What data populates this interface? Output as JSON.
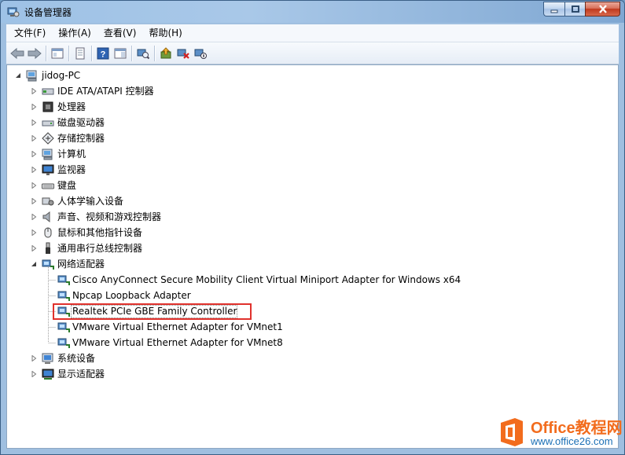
{
  "window": {
    "title": "设备管理器"
  },
  "menu": [
    {
      "key": "file",
      "label": "文件(F)"
    },
    {
      "key": "action",
      "label": "操作(A)"
    },
    {
      "key": "view",
      "label": "查看(V)"
    },
    {
      "key": "help",
      "label": "帮助(H)"
    }
  ],
  "tree": {
    "root": "jidog-PC",
    "categories": [
      {
        "key": "ide",
        "label": "IDE ATA/ATAPI 控制器",
        "icon": "ide-controller-icon"
      },
      {
        "key": "cpu",
        "label": "处理器",
        "icon": "processor-icon"
      },
      {
        "key": "disk",
        "label": "磁盘驱动器",
        "icon": "disk-drive-icon"
      },
      {
        "key": "storage",
        "label": "存储控制器",
        "icon": "storage-controller-icon"
      },
      {
        "key": "computer",
        "label": "计算机",
        "icon": "computer-icon"
      },
      {
        "key": "monitor",
        "label": "监视器",
        "icon": "monitor-icon"
      },
      {
        "key": "keyboard",
        "label": "键盘",
        "icon": "keyboard-icon"
      },
      {
        "key": "hid",
        "label": "人体学输入设备",
        "icon": "hid-icon"
      },
      {
        "key": "sound",
        "label": "声音、视频和游戏控制器",
        "icon": "speaker-icon"
      },
      {
        "key": "mouse",
        "label": "鼠标和其他指针设备",
        "icon": "mouse-icon"
      },
      {
        "key": "usb",
        "label": "通用串行总线控制器",
        "icon": "usb-icon"
      },
      {
        "key": "network",
        "label": "网络适配器",
        "icon": "network-adapter-icon"
      }
    ],
    "network_children": [
      "Cisco AnyConnect Secure Mobility Client Virtual Miniport Adapter for Windows x64",
      "Npcap Loopback Adapter",
      "Realtek PCIe GBE Family Controller",
      "VMware Virtual Ethernet Adapter for VMnet1",
      "VMware Virtual Ethernet Adapter for VMnet8"
    ],
    "after": [
      {
        "key": "system",
        "label": "系统设备",
        "icon": "system-device-icon"
      },
      {
        "key": "display",
        "label": "显示适配器",
        "icon": "display-adapter-icon"
      }
    ],
    "selected": "Realtek PCIe GBE Family Controller"
  },
  "watermark": {
    "brand": "Office教程网",
    "url": "www.office26.com"
  },
  "colors": {
    "highlight_box": "#e0312c",
    "brand_orange": "#f26c1d",
    "brand_blue": "#1a6fb5"
  }
}
